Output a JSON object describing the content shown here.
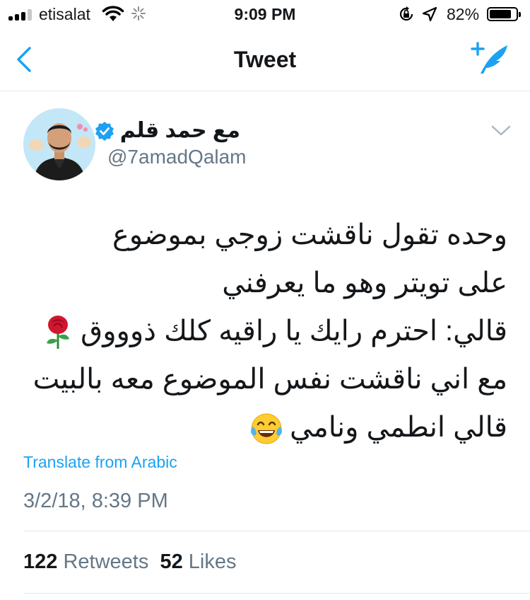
{
  "status_bar": {
    "carrier": "etisalat",
    "time": "9:09 PM",
    "battery_percent": "82%",
    "battery_level": 0.82,
    "signal_bars_filled": 3,
    "signal_bars_total": 4
  },
  "nav": {
    "title": "Tweet",
    "back_icon": "chevron-left-icon",
    "compose_icon": "compose-tweet-icon",
    "accent": "#1da1f2"
  },
  "tweet": {
    "author_name": "مع حمد قلم",
    "verified": true,
    "handle": "@7amadQalam",
    "lines": [
      "وحده تقول ناقشت زوجي بموضوع",
      "على تويتر وهو ما يعرفني",
      "قالي: احترم رايك يا راقيه كلك ذوووق",
      "مع اني ناقشت نفس الموضوع معه بالبيت",
      "قالي انطمي ونامي"
    ],
    "emojis": {
      "line_3": "rose-emoji",
      "line_5": "tears-of-joy-emoji"
    },
    "translate_label": "Translate from Arabic",
    "timestamp": "3/2/18, 8:39 PM",
    "retweets_count": "122",
    "retweets_label": "Retweets",
    "likes_count": "52",
    "likes_label": "Likes"
  }
}
